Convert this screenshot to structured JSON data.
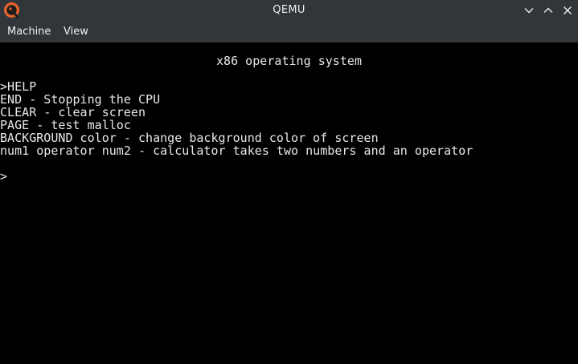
{
  "window": {
    "title": "QEMU",
    "icon": "qemu-logo-icon",
    "controls": [
      "chevron-down-icon",
      "chevron-up-icon",
      "close-icon"
    ]
  },
  "menubar": {
    "items": [
      "Machine",
      "View"
    ]
  },
  "console": {
    "heading": "x86 operating system",
    "lines": [
      ">HELP",
      "END - Stopping the CPU",
      "CLEAR - clear screen",
      "PAGE - test malloc",
      "BACKGROUND color - change background color of screen",
      "num1 operator num2 - calculator takes two numbers and an operator",
      "",
      ">"
    ]
  },
  "colors": {
    "chrome": "#31363b",
    "chrome_text": "#eff0f1",
    "console_bg": "#000000",
    "console_text": "#e8e8e8"
  }
}
